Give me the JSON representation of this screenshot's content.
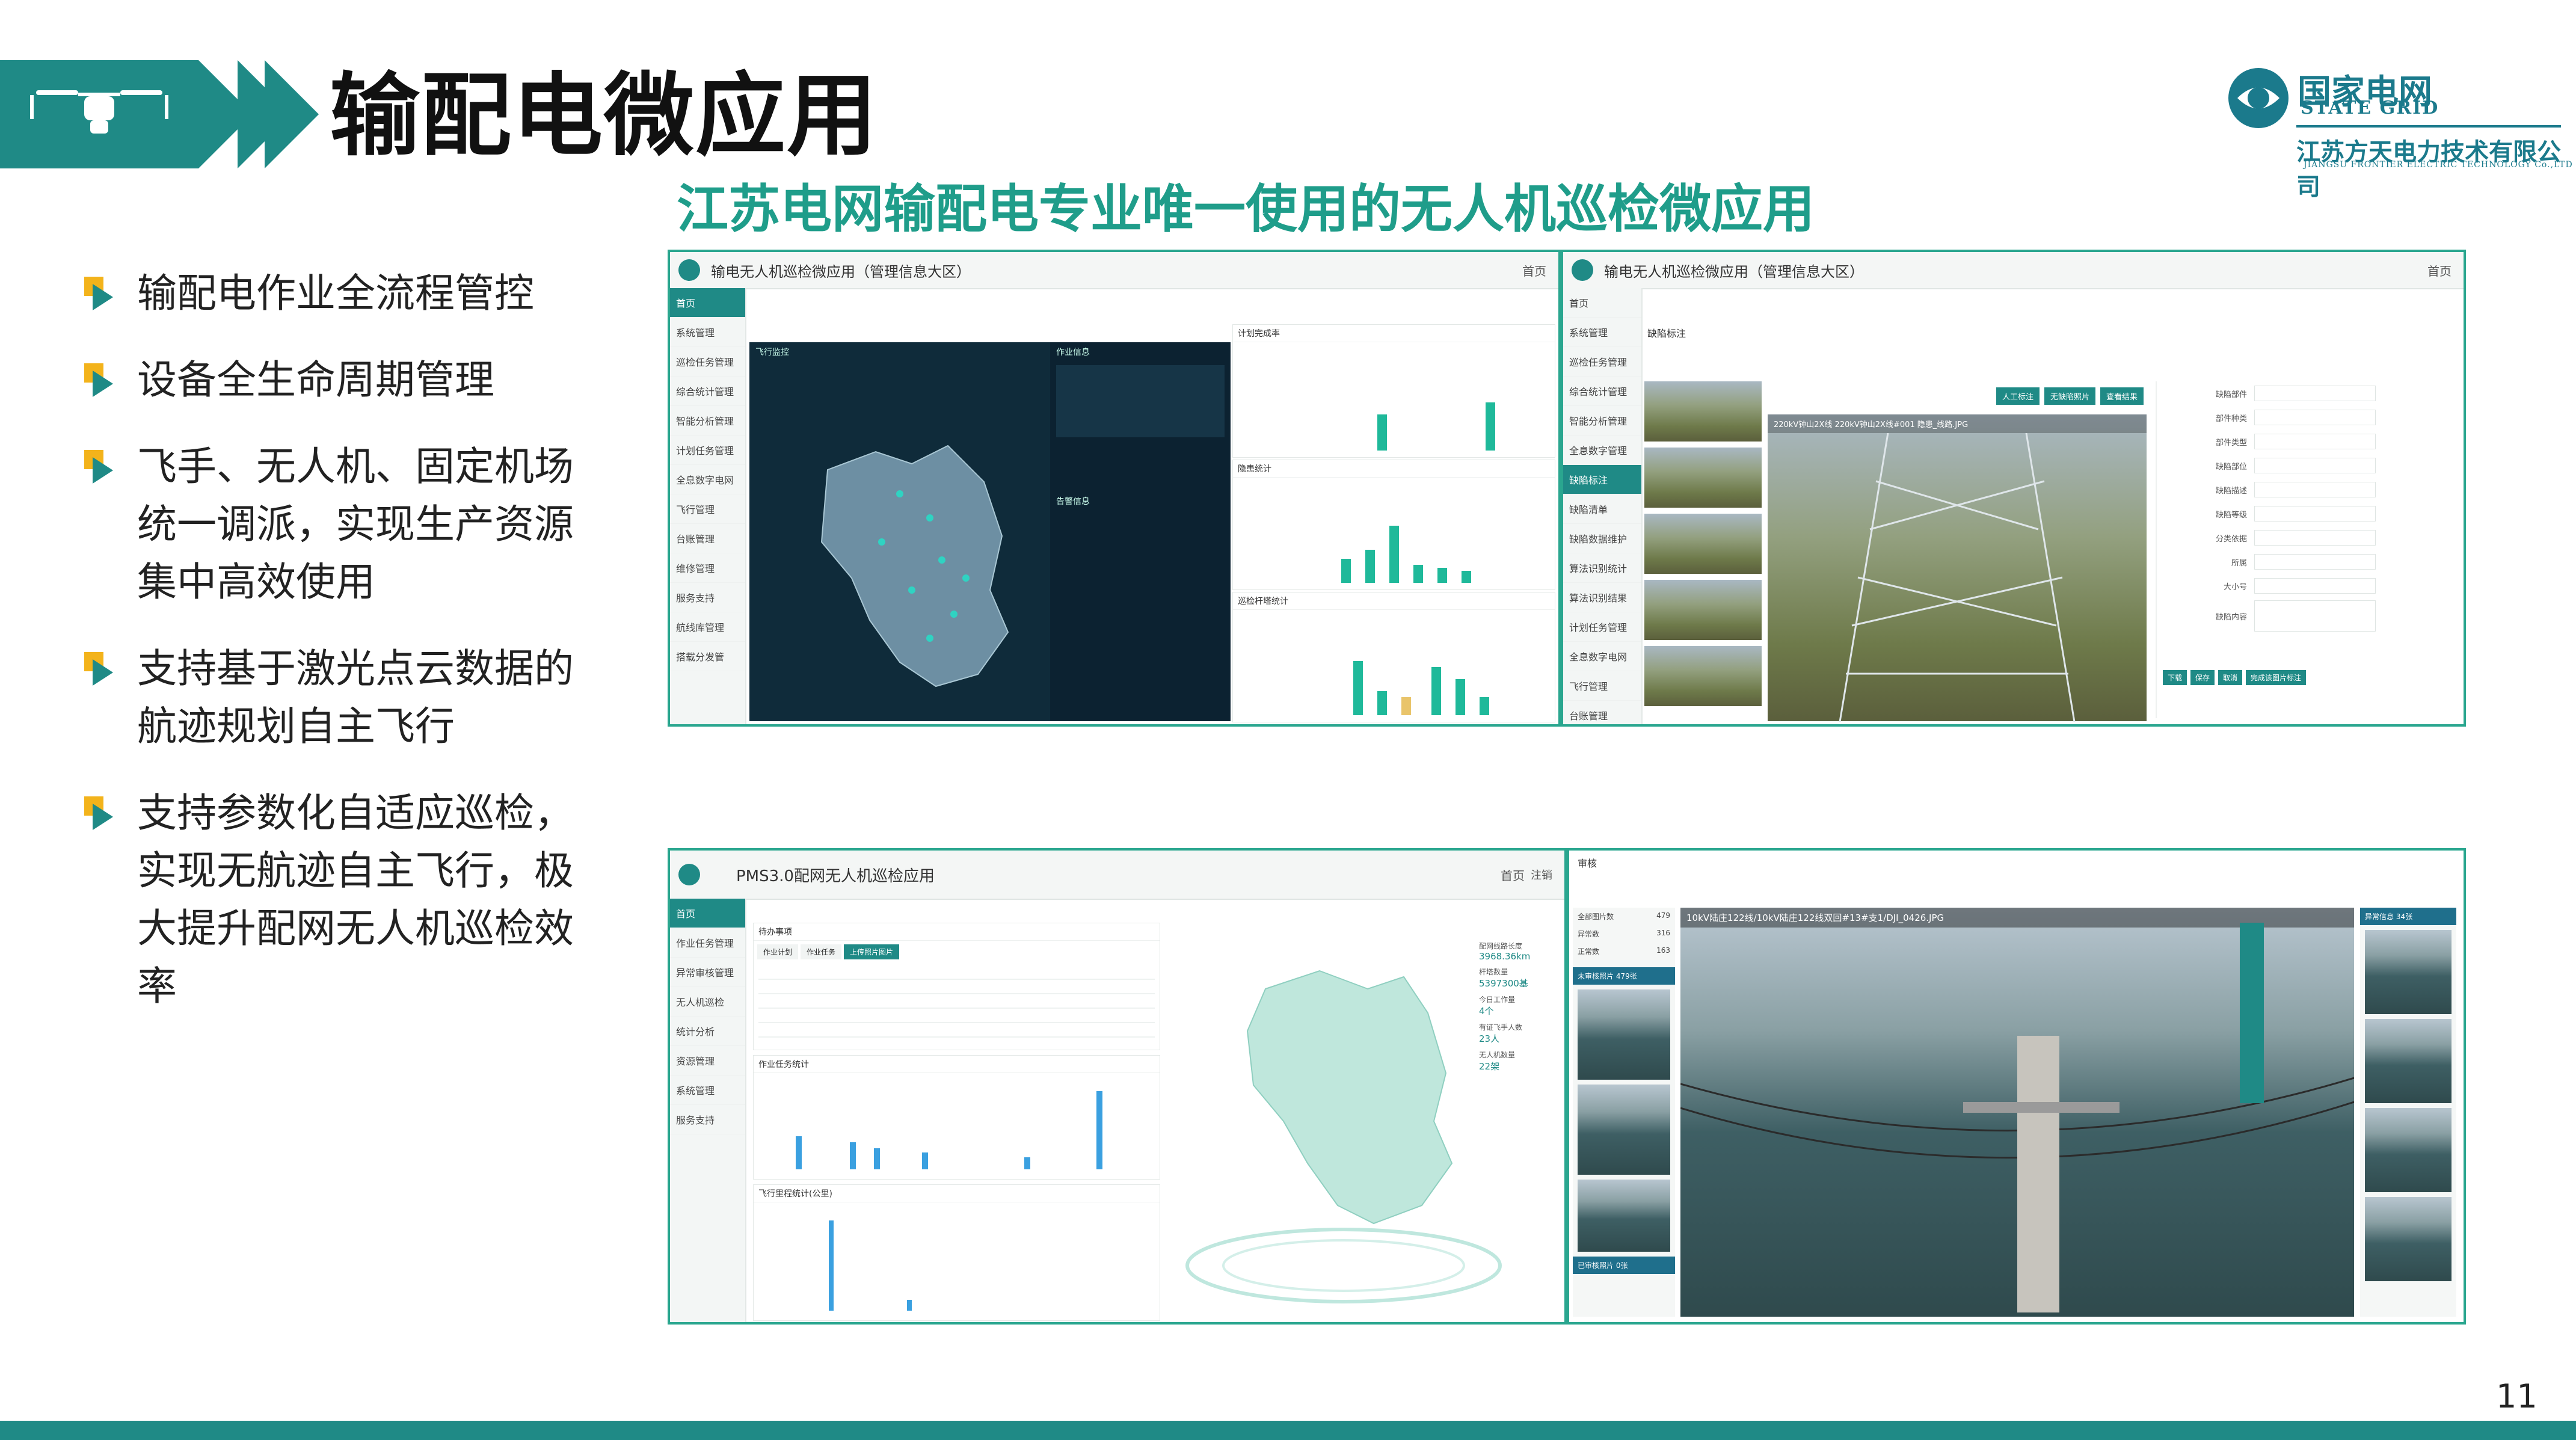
{
  "header": {
    "title": "输配电微应用",
    "subtitle": "江苏电网输配电专业唯一使用的无人机巡检微应用",
    "logo_cn": "国家电网",
    "logo_en": "STATE GRID",
    "company": "江苏方天电力技术有限公司",
    "company_en": "JIANGSU FRONTIER ELECTRIC TECHNOLOGY Co.,LTD"
  },
  "bullets": [
    "输配电作业全流程管控",
    "设备全生命周期管理",
    "飞手、无人机、固定机场统一调派，实现生产资源集中高效使用",
    "支持基于激光点云数据的航迹规划自主飞行",
    "支持参数化自适应巡检，实现无航迹自主飞行，极大提升配网无人机巡检效率"
  ],
  "screens": {
    "s1": {
      "title": "输电无人机巡检微应用（管理信息大区）",
      "home": "首页",
      "menu": [
        "首页",
        "系统管理",
        "巡检任务管理",
        "综合统计管理",
        "智能分析管理",
        "计划任务管理",
        "全息数字电网",
        "飞行管理",
        "台账管理",
        "维修管理",
        "服务支持",
        "航线库管理",
        "搭载分发管"
      ],
      "cards": [
        "飞行监控",
        "作业信息",
        "计划完成率",
        "隐患统计",
        "巡检杆塔统计",
        "告警信息"
      ]
    },
    "s2": {
      "title": "输电无人机巡检微应用（管理信息大区）",
      "home": "首页",
      "menu": [
        "首页",
        "系统管理",
        "巡检任务管理",
        "综合统计管理",
        "智能分析管理",
        "全息数字管理",
        "缺陷标注",
        "缺陷清单",
        "缺陷数据维护",
        "算法识别统计",
        "算法识别结果",
        "计划任务管理",
        "全息数字电网",
        "飞行管理",
        "台账管理"
      ],
      "panel_title": "缺陷标注",
      "image_caption": "220kV钟山2X线 220kV钟山2X线#001 隐患_线路.JPG",
      "buttons": [
        "人工标注",
        "无缺陷照片",
        "查看结果"
      ],
      "form_fields": [
        "缺陷部件",
        "部件种类",
        "部件类型",
        "缺陷部位",
        "缺陷描述",
        "缺陷等级",
        "分类依据",
        "所属",
        "大小号",
        "缺陷内容"
      ],
      "actions": [
        "下载",
        "保存",
        "取消",
        "完成该图片标注"
      ]
    },
    "s3": {
      "title": "PMS3.0配网无人机巡检应用",
      "home": "首页",
      "user": "注销",
      "menu": [
        "首页",
        "作业任务管理",
        "异常审核管理",
        "无人机巡检",
        "统计分析",
        "资源管理",
        "系统管理",
        "服务支持"
      ],
      "todo": "待办事项",
      "tabs": [
        "作业计划",
        "作业任务",
        "上传照片图片"
      ],
      "task_stats": "作业任务统计",
      "flight_stats": "飞行里程统计(公里)",
      "stats": [
        {
          "label": "配网线路长度",
          "value": "3968.36km"
        },
        {
          "label": "杆塔数量",
          "value": "5397300基"
        },
        {
          "label": "今日工作量",
          "value": "4个"
        },
        {
          "label": "有证飞手人数",
          "value": "23人"
        },
        {
          "label": "无人机数量",
          "value": "22架"
        }
      ]
    },
    "s4": {
      "title": "审核",
      "image_name": "10kV陆庄122线/10kV陆庄122线双回#13#支1/DJI_0426.JPG",
      "counts": [
        {
          "label": "全部图片数",
          "value": "479"
        },
        {
          "label": "异常数",
          "value": "316"
        },
        {
          "label": "正常数",
          "value": "163"
        }
      ],
      "thumb_title": "未审核照片 479张",
      "thumb_footer": "已审核照片 0张",
      "right_title": "异常信息 34张"
    }
  },
  "page_number": "11",
  "colors": {
    "teal": "#1f8a86",
    "green": "#2aa68f",
    "yellow": "#f3b31b"
  }
}
